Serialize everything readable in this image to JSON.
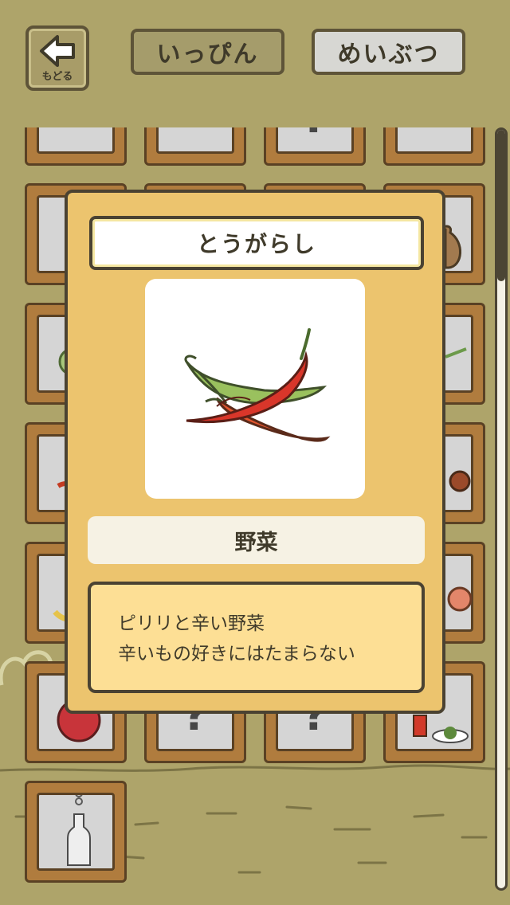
{
  "header": {
    "back_label": "もどる",
    "tabs": [
      {
        "label": "いっぴん",
        "selected": true
      },
      {
        "label": "めいぶつ",
        "selected": false
      }
    ]
  },
  "grid": {
    "unknown_mark": "?"
  },
  "item": {
    "name": "とうがらし",
    "image_icon": "chili-pepper",
    "category": "野菜",
    "description_lines": [
      "ピリリと辛い野菜",
      "辛いもの好きにはたまらない"
    ]
  },
  "colors": {
    "background": "#aea46a",
    "card": "#ecc46e",
    "frame": "#b07c3e",
    "description_bg": "#fddf95"
  }
}
